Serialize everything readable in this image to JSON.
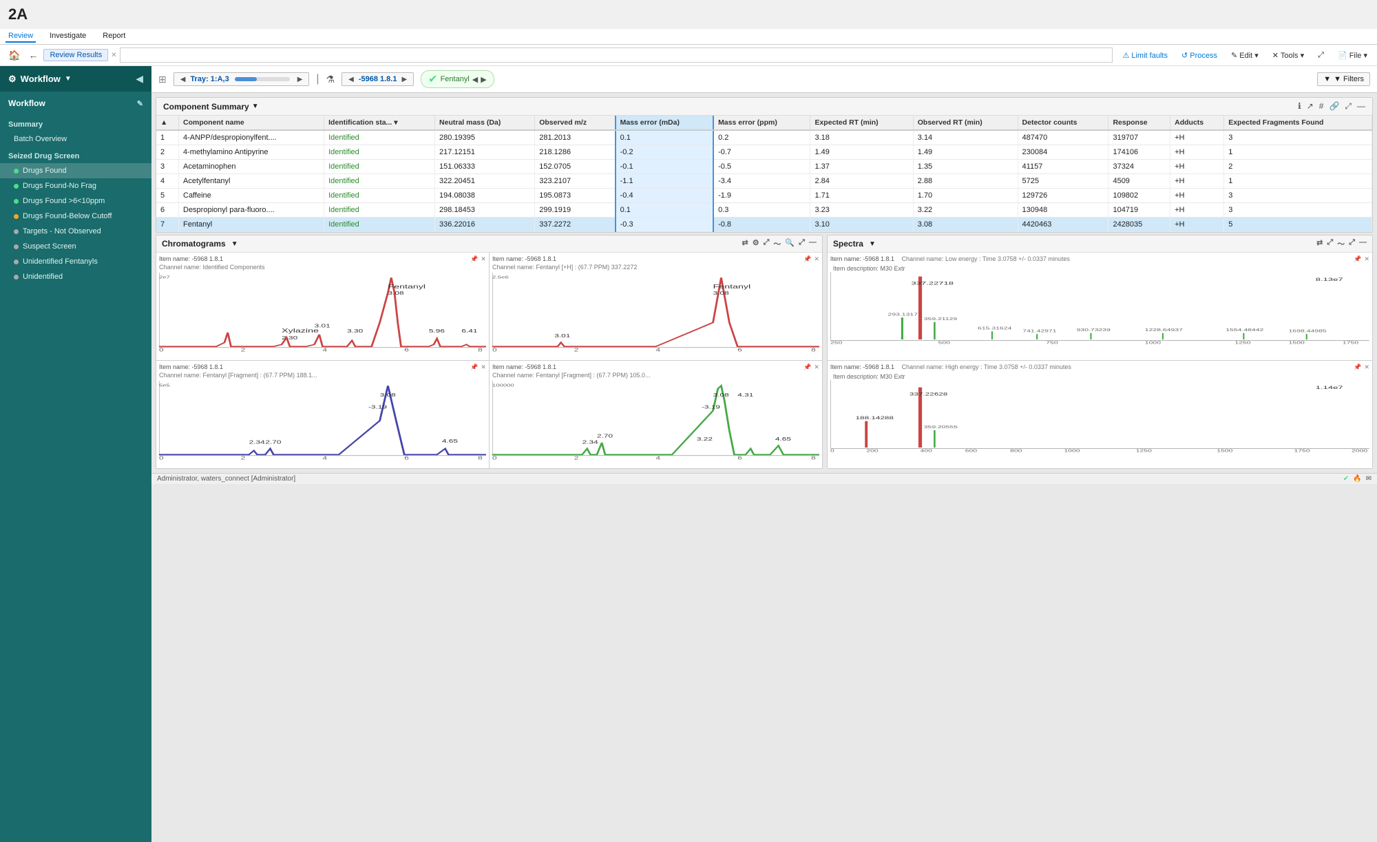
{
  "page": {
    "label": "2A"
  },
  "top_menu": {
    "items": [
      "Review",
      "Investigate",
      "Report"
    ],
    "active": "Review"
  },
  "toolbar": {
    "home_label": "🏠",
    "back_label": "←",
    "breadcrumb": "Review Results",
    "search_placeholder": "",
    "buttons": [
      "Limit faults",
      "Process",
      "Edit ▾",
      "✕ Tools ▾",
      "File ▾"
    ]
  },
  "sample_bar": {
    "tray_label": "Tray: 1:A,3",
    "sample_label": "-5968 1.8.1",
    "compound_label": "Fentanyl",
    "filter_label": "▼ Filters"
  },
  "component_summary": {
    "title": "Component Summary",
    "columns": [
      "",
      "Component name",
      "Identification sta...",
      "Neutral mass (Da)",
      "Observed m/z",
      "Mass error (mDa)",
      "Mass error (ppm)",
      "Expected RT (min)",
      "Observed RT (min)",
      "Detector counts",
      "Response",
      "Adducts",
      "Expected Fragments Found"
    ],
    "rows": [
      {
        "num": "1",
        "name": "4-ANPP/despropionylfent....",
        "status": "Identified",
        "neutral_mass": "280.19395",
        "obs_mz": "281.2013",
        "mass_err_mda": "0.1",
        "mass_err_ppm": "0.2",
        "exp_rt": "3.18",
        "obs_rt": "3.14",
        "det_counts": "487470",
        "response": "319707",
        "adducts": "+H",
        "exp_frag": "3"
      },
      {
        "num": "2",
        "name": "4-methylamino Antipyrine",
        "status": "Identified",
        "neutral_mass": "217.12151",
        "obs_mz": "218.1286",
        "mass_err_mda": "-0.2",
        "mass_err_ppm": "-0.7",
        "exp_rt": "1.49",
        "obs_rt": "1.49",
        "det_counts": "230084",
        "response": "174106",
        "adducts": "+H",
        "exp_frag": "1"
      },
      {
        "num": "3",
        "name": "Acetaminophen",
        "status": "Identified",
        "neutral_mass": "151.06333",
        "obs_mz": "152.0705",
        "mass_err_mda": "-0.1",
        "mass_err_ppm": "-0.5",
        "exp_rt": "1.37",
        "obs_rt": "1.35",
        "det_counts": "41157",
        "response": "37324",
        "adducts": "+H",
        "exp_frag": "2"
      },
      {
        "num": "4",
        "name": "Acetylfentanyl",
        "status": "Identified",
        "neutral_mass": "322.20451",
        "obs_mz": "323.2107",
        "mass_err_mda": "-1.1",
        "mass_err_ppm": "-3.4",
        "exp_rt": "2.84",
        "obs_rt": "2.88",
        "det_counts": "5725",
        "response": "4509",
        "adducts": "+H",
        "exp_frag": "1"
      },
      {
        "num": "5",
        "name": "Caffeine",
        "status": "Identified",
        "neutral_mass": "194.08038",
        "obs_mz": "195.0873",
        "mass_err_mda": "-0.4",
        "mass_err_ppm": "-1.9",
        "exp_rt": "1.71",
        "obs_rt": "1.70",
        "det_counts": "129726",
        "response": "109802",
        "adducts": "+H",
        "exp_frag": "3"
      },
      {
        "num": "6",
        "name": "Despropionyl para-fluoro....",
        "status": "Identified",
        "neutral_mass": "298.18453",
        "obs_mz": "299.1919",
        "mass_err_mda": "0.1",
        "mass_err_ppm": "0.3",
        "exp_rt": "3.23",
        "obs_rt": "3.22",
        "det_counts": "130948",
        "response": "104719",
        "adducts": "+H",
        "exp_frag": "3"
      },
      {
        "num": "7",
        "name": "Fentanyl",
        "status": "Identified",
        "neutral_mass": "336.22016",
        "obs_mz": "337.2272",
        "mass_err_mda": "-0.3",
        "mass_err_ppm": "-0.8",
        "exp_rt": "3.10",
        "obs_rt": "3.08",
        "det_counts": "4420463",
        "response": "2428035",
        "adducts": "+H",
        "exp_frag": "5"
      }
    ]
  },
  "sidebar": {
    "workflow_label": "Workflow",
    "sections": [
      {
        "label": "Summary",
        "items": [
          {
            "name": "Batch Overview",
            "dot": null
          }
        ]
      },
      {
        "label": "Seized Drug Screen",
        "items": [
          {
            "name": "Drugs Found",
            "dot": "green",
            "active": true
          },
          {
            "name": "Drugs Found-No Frag",
            "dot": "green"
          },
          {
            "name": "Drugs Found >6<10ppm",
            "dot": "green"
          },
          {
            "name": "Drugs Found-Below Cutoff",
            "dot": "orange"
          },
          {
            "name": "Targets - Not Observed",
            "dot": "gray"
          },
          {
            "name": "Suspect Screen",
            "dot": "gray"
          },
          {
            "name": "Unidentified Fentanyls",
            "dot": "gray"
          },
          {
            "name": "Unidentified",
            "dot": "gray"
          }
        ]
      }
    ]
  },
  "chromatograms": {
    "title": "Chromatograms",
    "panels": [
      {
        "item_name": "Item name: -5968 1.8.1",
        "channel": "Channel name: Identified Components",
        "peak_label": "Fentanyl 3.08",
        "extra_labels": [
          "Xylazine 2.30",
          "3.01",
          "3.30",
          "5.96",
          "6.41"
        ]
      },
      {
        "item_name": "Item name: -5968 1.8.1",
        "channel": "Channel name: Fentanyl [+H] : (67.7 PPM) 337.2272",
        "peak_label": "Fentanyl 3.08",
        "extra_labels": [
          "3.01"
        ]
      },
      {
        "item_name": "Item name: -5968 1.8.1",
        "channel": "Channel name: Fentanyl [Fragment] : (67.7 PPM) 188.1...",
        "peak_label": "3.08",
        "extra_labels": [
          "-3.19",
          "2.34",
          "2.70",
          "4.65"
        ]
      },
      {
        "item_name": "Item name: -5968 1.8.1",
        "channel": "Channel name: Fentanyl [Fragment] : (67.7 PPM) 105.0...",
        "peak_label": "3.08",
        "extra_labels": [
          "4.31",
          "-3.19",
          "2.34",
          "2.70",
          "3.22",
          "4.65"
        ]
      }
    ]
  },
  "spectra": {
    "title": "Spectra",
    "panels": [
      {
        "item_name": "Item name: -5968 1.8.1",
        "channel": "Channel name: Low energy : Time 3.0758 +/- 0.0337 minutes",
        "item_desc": "Item description: M30 Extr",
        "major_peak": "337.22718",
        "y_max": "8.13e7",
        "peaks": [
          "293.13171",
          "359.21129",
          "615.31624",
          "741.42971",
          "930.73239",
          "1228.64937",
          "1554.48442",
          "1698.44985"
        ]
      },
      {
        "item_name": "Item name: -5968 1.8.1",
        "channel": "Channel name: High energy : Time 3.0758 +/- 0.0337 minutes",
        "item_desc": "Item description: M30 Extr",
        "major_peak": "337.22628",
        "y_max": "1.14e7",
        "peaks": [
          "188.14288",
          "359.20555"
        ]
      }
    ]
  },
  "status_bar": {
    "user": "Administrator, waters_connect [Administrator]",
    "icons": [
      "✔",
      "🔥",
      "✉"
    ]
  }
}
